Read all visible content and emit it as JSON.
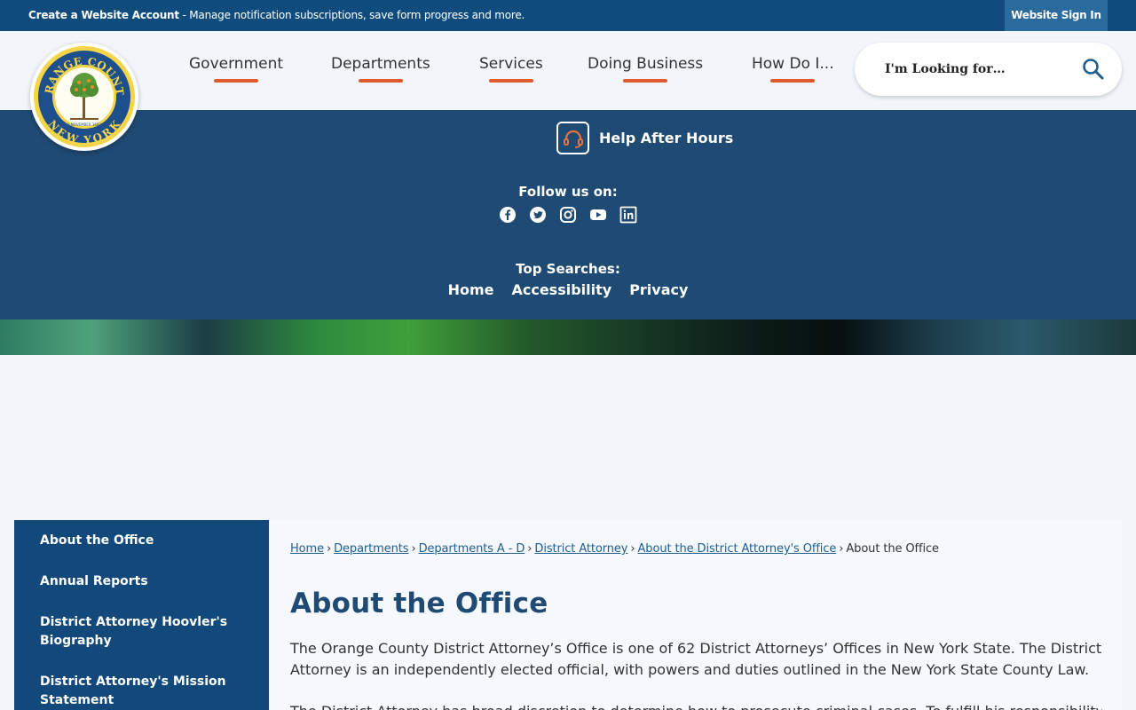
{
  "topbar": {
    "account_bold": "Create a Website Account",
    "account_rest": " - Manage notification subscriptions, save form progress and more.",
    "signin": "Website Sign In"
  },
  "logo": {
    "top_text": "ORANGE COUNTY",
    "bottom_text": "NEW YORK",
    "date_text": "1 NOVEMBER 1683"
  },
  "nav": [
    {
      "label": "Government"
    },
    {
      "label": "Departments"
    },
    {
      "label": "Services"
    },
    {
      "label": "Doing Business"
    },
    {
      "label": "How Do I..."
    }
  ],
  "search": {
    "placeholder": "I'm Looking for…"
  },
  "band": {
    "help_label": "Help After Hours",
    "follow_label": "Follow us on:",
    "socials": [
      "facebook-icon",
      "twitter-icon",
      "instagram-icon",
      "youtube-icon",
      "linkedin-icon"
    ],
    "top_searches_label": "Top Searches:",
    "top_searches": [
      "Home",
      "Accessibility",
      "Privacy"
    ]
  },
  "sidebar": {
    "items": [
      {
        "label": "About the Office"
      },
      {
        "label": "Annual Reports"
      },
      {
        "label": "District Attorney Hoovler's Biography"
      },
      {
        "label": "District Attorney's Mission Statement"
      }
    ]
  },
  "breadcrumb": [
    "Home",
    "Departments",
    "Departments A - D",
    "District Attorney",
    "About the District Attorney's Office",
    "About the Office"
  ],
  "page": {
    "title": "About the Office",
    "paragraph1": "The Orange County District Attorney’s Office is one of 62 District Attorneys’ Offices in New York State. The District Attorney is an independently elected official, with powers and duties outlined in the New York State County Law.",
    "paragraph2": "The District Attorney has broad discretion to determine how to prosecute criminal cases. To fulfill his responsibility"
  },
  "colors": {
    "topbar": "#0f4c7d",
    "band": "#1f4a74",
    "accent": "#e05a2b",
    "sidebar": "#12497a",
    "title": "#1f4a74"
  }
}
